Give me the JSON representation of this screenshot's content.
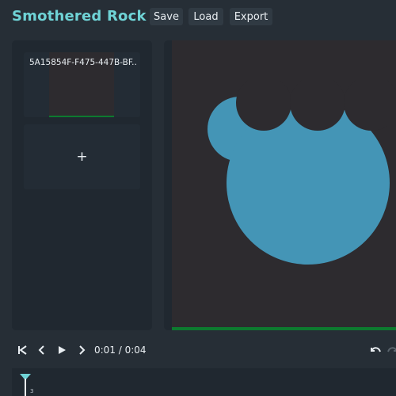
{
  "app": {
    "title": "Smothered Rock"
  },
  "toolbar": {
    "save_label": "Save",
    "load_label": "Load",
    "export_label": "Export"
  },
  "frames": {
    "items": [
      {
        "label": "5A15854F-F475-447B-BF..."
      }
    ],
    "add_label": "+"
  },
  "playback": {
    "time": "0:01 / 0:04"
  },
  "timeline": {
    "marker_label": "3"
  },
  "colors": {
    "accent": "#6fd3d6",
    "shape": "#4495b6",
    "shadow_shape": "#2d2b2f",
    "stage_background": "#2d2b2f",
    "stage_accent_line": "#0d7a2f"
  },
  "icons": {
    "skip_start": "skip-to-start-icon",
    "prev_frame": "previous-frame-icon",
    "play": "play-icon",
    "next_frame": "next-frame-icon",
    "undo": "undo-icon",
    "redo": "redo-icon",
    "add": "plus-icon"
  }
}
